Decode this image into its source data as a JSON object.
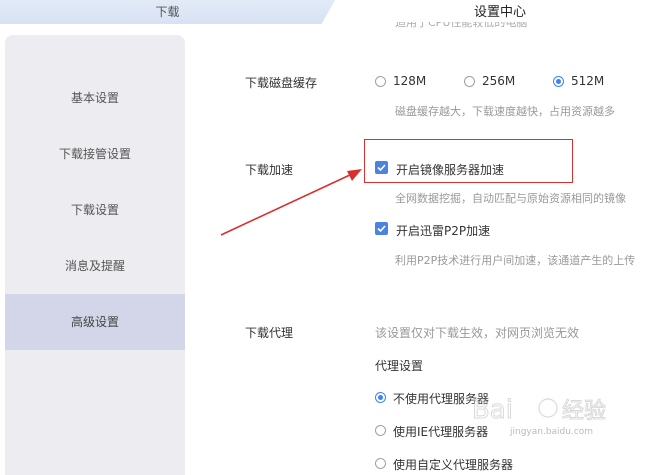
{
  "tabs": {
    "download": "下载",
    "settings": "设置中心"
  },
  "sidebar": {
    "items": [
      {
        "label": "基本设置",
        "active": false
      },
      {
        "label": "下载接管设置",
        "active": false
      },
      {
        "label": "下载设置",
        "active": false
      },
      {
        "label": "消息及提醒",
        "active": false
      },
      {
        "label": "高级设置",
        "active": true
      }
    ]
  },
  "main": {
    "top_clipped_text": "适用于CPU性能较低的电脑",
    "disk_cache": {
      "label": "下载磁盘缓存",
      "options": [
        "128M",
        "256M",
        "512M"
      ],
      "selected": "512M",
      "hint": "磁盘缓存越大，下载速度越快，占用资源越多"
    },
    "acceleration": {
      "label": "下载加速",
      "mirror": {
        "label": "开启镜像服务器加速",
        "checked": true,
        "hint": "全网数据挖掘，自动匹配与原始资源相同的镜像"
      },
      "p2p": {
        "label": "开启迅雷P2P加速",
        "checked": true,
        "hint": "利用P2P技术进行用户间加速，该通道产生的上传"
      }
    },
    "proxy": {
      "label": "下载代理",
      "note": "该设置仅对下载生效，对网页浏览无效",
      "subheading": "代理设置",
      "options": [
        "不使用代理服务器",
        "使用IE代理服务器",
        "使用自定义代理服务器"
      ],
      "selected": "不使用代理服务器"
    }
  },
  "watermark": {
    "text": "jingyan.baidu.com"
  },
  "colors": {
    "accent": "#3b82f6",
    "annotation": "#d9302f"
  }
}
